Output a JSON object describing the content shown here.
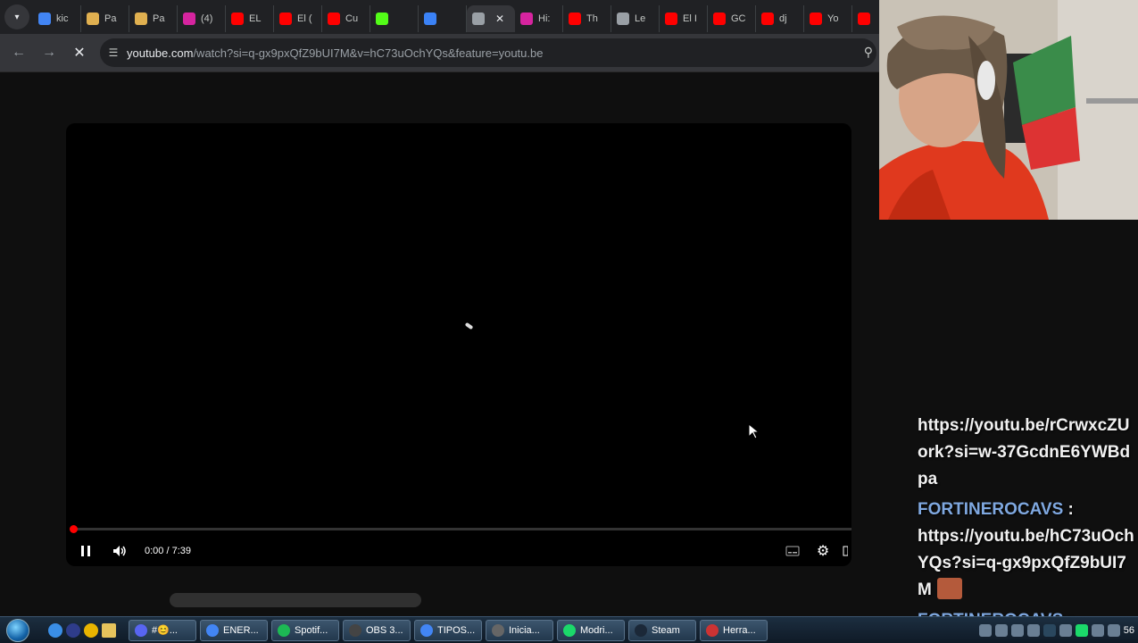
{
  "browser": {
    "tabs": [
      {
        "label": "kic",
        "icon": "google-icon",
        "color": "#4285f4"
      },
      {
        "label": "Pa",
        "icon": "ticket-icon",
        "color": "#e0b050"
      },
      {
        "label": "Pa",
        "icon": "ticket-icon",
        "color": "#e0b050"
      },
      {
        "label": "(4)",
        "icon": "instagram-icon",
        "color": "#d6249f"
      },
      {
        "label": "EL",
        "icon": "youtube-icon",
        "color": "#ff0000"
      },
      {
        "label": "El (",
        "icon": "youtube-icon",
        "color": "#ff0000"
      },
      {
        "label": "Cu",
        "icon": "youtube-icon",
        "color": "#ff0000"
      },
      {
        "label": "",
        "icon": "kick-icon",
        "color": "#53fc18"
      },
      {
        "label": "",
        "icon": "monitor-icon",
        "color": "#3b82f6"
      },
      {
        "label": "",
        "icon": "loading-icon",
        "color": "#9aa0a6",
        "active": true
      },
      {
        "label": "Hi:",
        "icon": "instagram-icon",
        "color": "#d6249f"
      },
      {
        "label": "Th",
        "icon": "youtube-icon",
        "color": "#ff0000"
      },
      {
        "label": "Le",
        "icon": "dots-icon",
        "color": "#9aa0a6"
      },
      {
        "label": "El I",
        "icon": "youtube-icon",
        "color": "#ff0000"
      },
      {
        "label": "GC",
        "icon": "youtube-icon",
        "color": "#ff0000"
      },
      {
        "label": "dj",
        "icon": "youtube-icon",
        "color": "#ff0000"
      },
      {
        "label": "Yo",
        "icon": "youtube-icon",
        "color": "#ff0000"
      },
      {
        "label": "",
        "icon": "youtube-icon",
        "color": "#ff0000"
      }
    ],
    "url_domain": "youtube.com",
    "url_rest": "/watch?si=q-gx9pxQfZ9bUI7M&v=hC73uOchYQs&feature=youtu.be"
  },
  "player": {
    "time": "0:00 / 7:39",
    "progress_fraction": 0.0
  },
  "chat": {
    "messages": [
      {
        "user": "",
        "text": "https://youtu.be/rCrwxcZUork?si=w-37GcdnE6YWBdpa"
      },
      {
        "user": "FORTINEROCAVS",
        "text": "https://youtu.be/hC73uOchYQs?si=q-gx9pxQfZ9bUI7M"
      },
      {
        "user": "FORTINEROCAVS",
        "text": ""
      }
    ]
  },
  "taskbar": {
    "tasks": [
      {
        "label": "#😊...",
        "icon": "discord-icon",
        "color": "#5865f2"
      },
      {
        "label": "ENER...",
        "icon": "chrome-icon",
        "color": "#4285f4"
      },
      {
        "label": "Spotif...",
        "icon": "spotify-icon",
        "color": "#1db954"
      },
      {
        "label": "OBS 3...",
        "icon": "obs-icon",
        "color": "#444"
      },
      {
        "label": "TIPOS...",
        "icon": "chrome-icon",
        "color": "#4285f4"
      },
      {
        "label": "Inicia...",
        "icon": "window-icon",
        "color": "#666"
      },
      {
        "label": "Modri...",
        "icon": "modrinth-icon",
        "color": "#1bd96a"
      },
      {
        "label": "Steam",
        "icon": "steam-icon",
        "color": "#1b2838"
      },
      {
        "label": "Herra...",
        "icon": "tool-icon",
        "color": "#c33"
      }
    ],
    "clock": "56"
  }
}
